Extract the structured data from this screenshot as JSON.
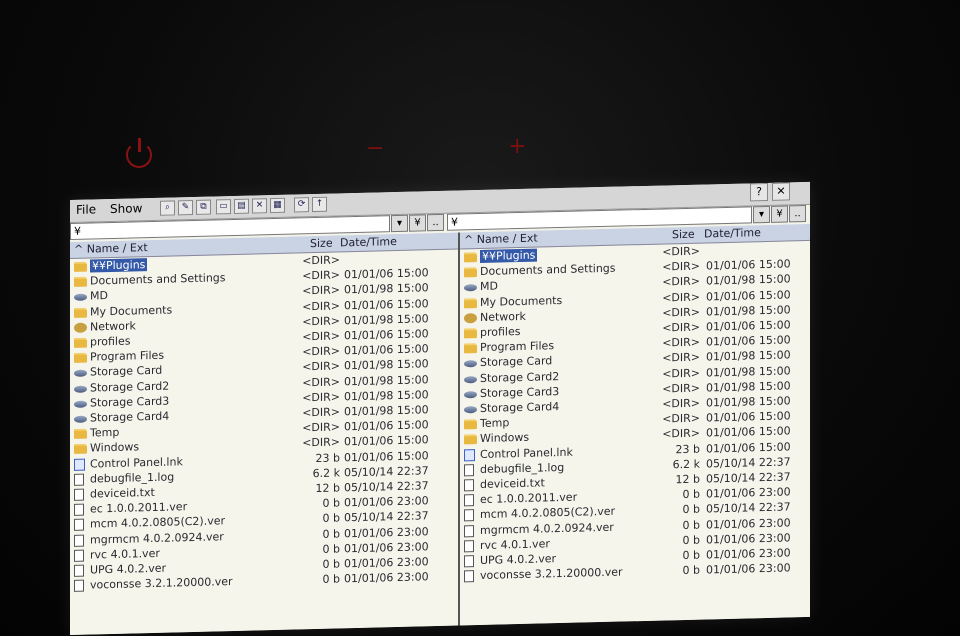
{
  "menu": {
    "file": "File",
    "show": "Show"
  },
  "window_buttons": {
    "help": "?",
    "close": "✕"
  },
  "left": {
    "path": "¥",
    "btn_up": "¥",
    "btn_parent": "..",
    "headers": {
      "name": "^ Name / Ext",
      "size": "Size",
      "date": "Date/Time"
    },
    "rows": [
      {
        "name": "¥¥Plugins",
        "size": "<DIR>",
        "date": "",
        "icon": "folder",
        "selected": true
      },
      {
        "name": "Documents and Settings",
        "size": "<DIR>",
        "date": "01/01/06 15:00",
        "icon": "folder"
      },
      {
        "name": "MD",
        "size": "<DIR>",
        "date": "01/01/98 15:00",
        "icon": "drive"
      },
      {
        "name": "My Documents",
        "size": "<DIR>",
        "date": "01/01/06 15:00",
        "icon": "folder"
      },
      {
        "name": "Network",
        "size": "<DIR>",
        "date": "01/01/98 15:00",
        "icon": "net"
      },
      {
        "name": "profiles",
        "size": "<DIR>",
        "date": "01/01/06 15:00",
        "icon": "folder"
      },
      {
        "name": "Program Files",
        "size": "<DIR>",
        "date": "01/01/06 15:00",
        "icon": "folder"
      },
      {
        "name": "Storage Card",
        "size": "<DIR>",
        "date": "01/01/98 15:00",
        "icon": "drive"
      },
      {
        "name": "Storage Card2",
        "size": "<DIR>",
        "date": "01/01/98 15:00",
        "icon": "drive"
      },
      {
        "name": "Storage Card3",
        "size": "<DIR>",
        "date": "01/01/98 15:00",
        "icon": "drive"
      },
      {
        "name": "Storage Card4",
        "size": "<DIR>",
        "date": "01/01/98 15:00",
        "icon": "drive"
      },
      {
        "name": "Temp",
        "size": "<DIR>",
        "date": "01/01/06 15:00",
        "icon": "folder"
      },
      {
        "name": "Windows",
        "size": "<DIR>",
        "date": "01/01/06 15:00",
        "icon": "folder"
      },
      {
        "name": "Control Panel.lnk",
        "size": "23 b",
        "date": "01/01/06 15:00",
        "icon": "lnk"
      },
      {
        "name": "debugfile_1.log",
        "size": "6.2 k",
        "date": "05/10/14 22:37",
        "icon": "file"
      },
      {
        "name": "deviceid.txt",
        "size": "12 b",
        "date": "05/10/14 22:37",
        "icon": "file"
      },
      {
        "name": "ec 1.0.0.2011.ver",
        "size": "0 b",
        "date": "01/01/06 23:00",
        "icon": "file"
      },
      {
        "name": "mcm 4.0.2.0805(C2).ver",
        "size": "0 b",
        "date": "05/10/14 22:37",
        "icon": "file"
      },
      {
        "name": "mgrmcm 4.0.2.0924.ver",
        "size": "0 b",
        "date": "01/01/06 23:00",
        "icon": "file"
      },
      {
        "name": "rvc 4.0.1.ver",
        "size": "0 b",
        "date": "01/01/06 23:00",
        "icon": "file"
      },
      {
        "name": "UPG 4.0.2.ver",
        "size": "0 b",
        "date": "01/01/06 23:00",
        "icon": "file"
      },
      {
        "name": "voconsse 3.2.1.20000.ver",
        "size": "0 b",
        "date": "01/01/06 23:00",
        "icon": "file"
      }
    ]
  },
  "right": {
    "path": "¥",
    "btn_up": "¥",
    "btn_parent": "..",
    "headers": {
      "name": "^ Name / Ext",
      "size": "Size",
      "date": "Date/Time"
    },
    "rows": [
      {
        "name": "¥¥Plugins",
        "size": "<DIR>",
        "date": "",
        "icon": "folder",
        "selected": true
      },
      {
        "name": "Documents and Settings",
        "size": "<DIR>",
        "date": "01/01/06 15:00",
        "icon": "folder"
      },
      {
        "name": "MD",
        "size": "<DIR>",
        "date": "01/01/98 15:00",
        "icon": "drive"
      },
      {
        "name": "My Documents",
        "size": "<DIR>",
        "date": "01/01/06 15:00",
        "icon": "folder"
      },
      {
        "name": "Network",
        "size": "<DIR>",
        "date": "01/01/98 15:00",
        "icon": "net"
      },
      {
        "name": "profiles",
        "size": "<DIR>",
        "date": "01/01/06 15:00",
        "icon": "folder"
      },
      {
        "name": "Program Files",
        "size": "<DIR>",
        "date": "01/01/06 15:00",
        "icon": "folder"
      },
      {
        "name": "Storage Card",
        "size": "<DIR>",
        "date": "01/01/98 15:00",
        "icon": "drive"
      },
      {
        "name": "Storage Card2",
        "size": "<DIR>",
        "date": "01/01/98 15:00",
        "icon": "drive"
      },
      {
        "name": "Storage Card3",
        "size": "<DIR>",
        "date": "01/01/98 15:00",
        "icon": "drive"
      },
      {
        "name": "Storage Card4",
        "size": "<DIR>",
        "date": "01/01/98 15:00",
        "icon": "drive"
      },
      {
        "name": "Temp",
        "size": "<DIR>",
        "date": "01/01/06 15:00",
        "icon": "folder"
      },
      {
        "name": "Windows",
        "size": "<DIR>",
        "date": "01/01/06 15:00",
        "icon": "folder"
      },
      {
        "name": "Control Panel.lnk",
        "size": "23 b",
        "date": "01/01/06 15:00",
        "icon": "lnk"
      },
      {
        "name": "debugfile_1.log",
        "size": "6.2 k",
        "date": "05/10/14 22:37",
        "icon": "file"
      },
      {
        "name": "deviceid.txt",
        "size": "12 b",
        "date": "05/10/14 22:37",
        "icon": "file"
      },
      {
        "name": "ec 1.0.0.2011.ver",
        "size": "0 b",
        "date": "01/01/06 23:00",
        "icon": "file"
      },
      {
        "name": "mcm 4.0.2.0805(C2).ver",
        "size": "0 b",
        "date": "05/10/14 22:37",
        "icon": "file"
      },
      {
        "name": "mgrmcm 4.0.2.0924.ver",
        "size": "0 b",
        "date": "01/01/06 23:00",
        "icon": "file"
      },
      {
        "name": "rvc 4.0.1.ver",
        "size": "0 b",
        "date": "01/01/06 23:00",
        "icon": "file"
      },
      {
        "name": "UPG 4.0.2.ver",
        "size": "0 b",
        "date": "01/01/06 23:00",
        "icon": "file"
      },
      {
        "name": "voconsse 3.2.1.20000.ver",
        "size": "0 b",
        "date": "01/01/06 23:00",
        "icon": "file"
      }
    ]
  },
  "hardware": {
    "minus": "−",
    "plus": "+"
  }
}
